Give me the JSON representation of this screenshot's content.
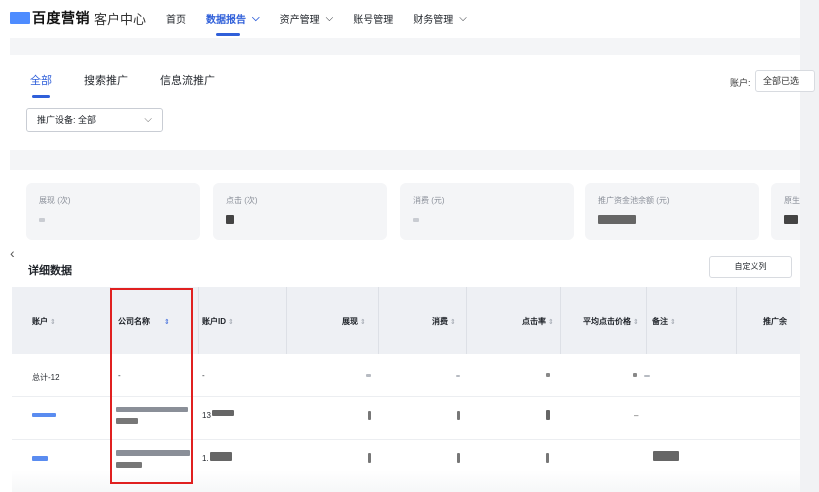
{
  "nav": {
    "logo": "百度营销",
    "sub": "客户中心",
    "items": [
      {
        "label": "首页",
        "active": false,
        "dropdown": false
      },
      {
        "label": "数据报告",
        "active": true,
        "dropdown": true
      },
      {
        "label": "资产管理",
        "active": false,
        "dropdown": true
      },
      {
        "label": "账号管理",
        "active": false,
        "dropdown": false
      },
      {
        "label": "财务管理",
        "active": false,
        "dropdown": true
      }
    ]
  },
  "tabs": [
    "全部",
    "搜索推广",
    "信息流推广"
  ],
  "account": {
    "label": "账户:",
    "value": "全部已选"
  },
  "device": {
    "label": "推广设备: 全部"
  },
  "cards": [
    {
      "label": "展现 (次)"
    },
    {
      "label": "点击 (次)"
    },
    {
      "label": "消费 (元)"
    },
    {
      "label": "推广资金池余额 (元)"
    },
    {
      "label": "原生"
    }
  ],
  "section_title": "详细数据",
  "custom_columns": "自定义列",
  "table": {
    "headers": [
      "账户",
      "公司名称",
      "账户ID",
      "展现",
      "消费",
      "点击率",
      "平均点击价格",
      "备注",
      "推广余"
    ],
    "total_row": {
      "account": "总计-12",
      "company": "-",
      "account_id": "-"
    },
    "row2": {
      "account_id_prefix": "13"
    },
    "row3": {
      "account_id_prefix": "1."
    }
  },
  "icons": {
    "sort": "sort-icon",
    "chevron": "chevron-down-icon",
    "back": "chevron-left-icon"
  },
  "colors": {
    "accent": "#2f5fd9",
    "highlight": "#e02020"
  }
}
